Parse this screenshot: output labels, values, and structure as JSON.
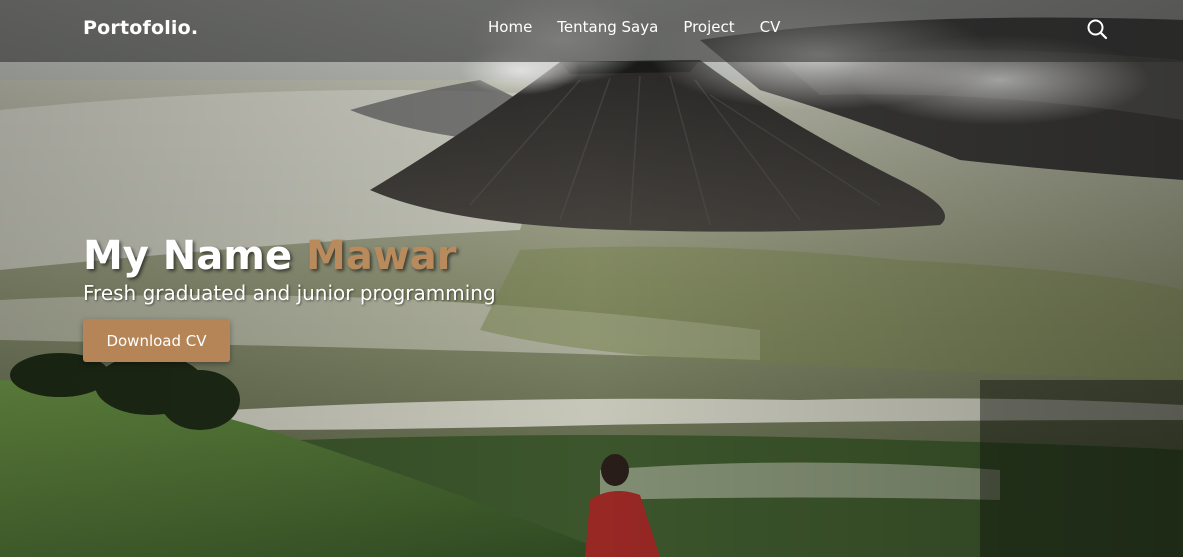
{
  "nav": {
    "brand": "Portofolio.",
    "links": [
      {
        "label": "Home"
      },
      {
        "label": "Tentang Saya"
      },
      {
        "label": "Project"
      },
      {
        "label": "CV"
      }
    ],
    "search_icon": "search-icon"
  },
  "hero": {
    "title_prefix": "My Name",
    "title_name": "Mawar",
    "subtitle": "Fresh graduated and junior programming",
    "cta_label": "Download CV",
    "background": "volcano-landscape-photo"
  },
  "colors": {
    "accent": "#b98a5c",
    "button": "#b58557",
    "nav_bg": "#282828",
    "text": "#ffffff"
  }
}
